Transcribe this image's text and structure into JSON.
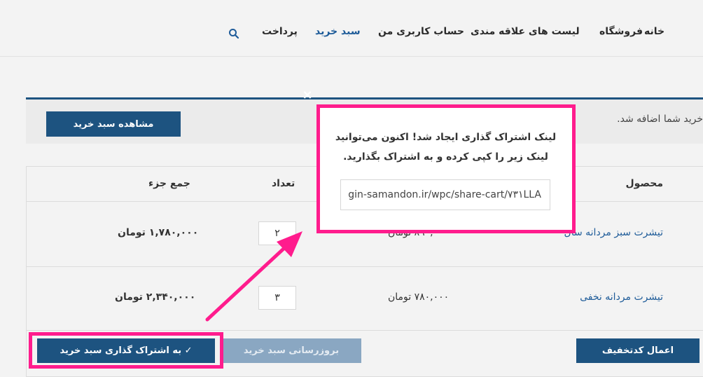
{
  "nav": {
    "items": [
      {
        "label": "خانه",
        "active": false
      },
      {
        "label": "فروشگاه",
        "active": false
      },
      {
        "label": "لیست های علاقه مندی",
        "active": false
      },
      {
        "label": "حساب کاربری من",
        "active": false
      },
      {
        "label": "سبد خرید",
        "active": true
      },
      {
        "label": "پرداخت",
        "active": false
      }
    ],
    "search_icon": "search-icon"
  },
  "notice": {
    "text": "خرید شما اضافه شد.",
    "view_cart_label": "مشاهده سبد خرید"
  },
  "cart": {
    "headers": {
      "product": "محصول",
      "quantity": "تعداد",
      "subtotal": "جمع جزء"
    },
    "rows": [
      {
        "name": "تیشرت سبز مردانه سال",
        "price": "۸۹۰,۰۰۰ تومان",
        "quantity": "۲",
        "subtotal": "۱,۷۸۰,۰۰۰ تومان"
      },
      {
        "name": "تیشرت مردانه نخفی",
        "price": "۷۸۰,۰۰۰ تومان",
        "quantity": "۳",
        "subtotal": "۲,۳۴۰,۰۰۰ تومان"
      }
    ],
    "coupon_label": "اعمال کدتخفیف",
    "update_label": "بروزرسانی سبد خرید",
    "share_label": "✓ به اشتراک گذاری سبد خرید"
  },
  "modal": {
    "close_symbol": "×",
    "message_line1": "لینک اشتراک گذاری ایجاد شد! اکنون می‌توانید",
    "message_line2": "لینک زیر را کپی کرده و به اشتراک بگذارید.",
    "share_url": "gin-samandon.ir/wpc/share-cart/۷۳۱LLA"
  },
  "colors": {
    "accent": "#1d5380",
    "link": "#1f5c99",
    "highlight": "#ff1c8d"
  }
}
